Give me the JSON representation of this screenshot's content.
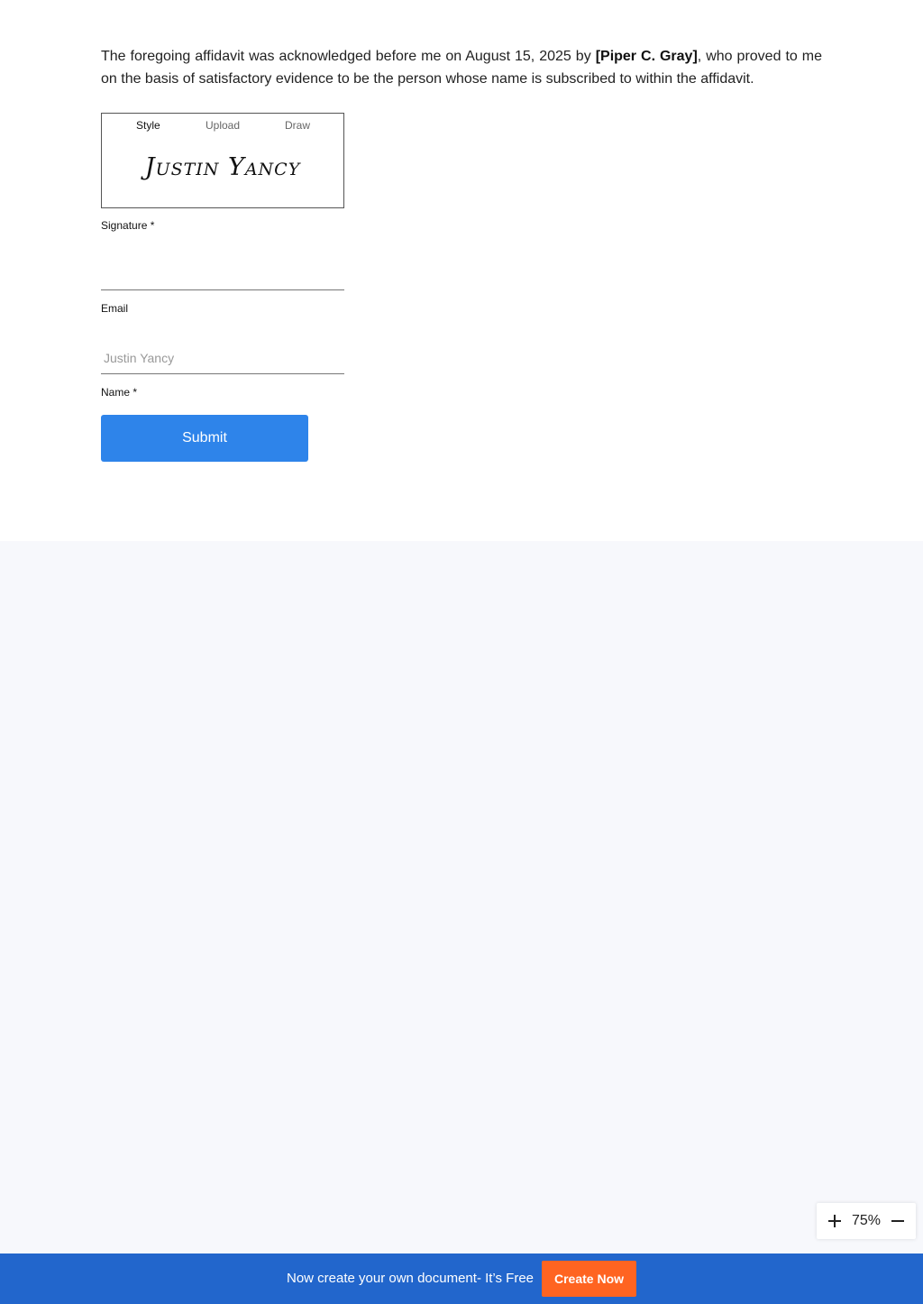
{
  "document": {
    "paragraph": {
      "before": "The foregoing affidavit was acknowledged before me on August 15, 2025 by ",
      "name": "[Piper C. Gray]",
      "after": ", who proved to me on the basis of satisfactory evidence to be the person whose name is subscribed to within the affidavit."
    }
  },
  "signature_box": {
    "tabs": [
      {
        "label": "Style",
        "active": true
      },
      {
        "label": "Upload",
        "active": false
      },
      {
        "label": "Draw",
        "active": false
      }
    ],
    "signature_text": "Justin Yancy"
  },
  "form": {
    "signature_label": "Signature *",
    "email_label": "Email",
    "email_placeholder": "Justin Yancy",
    "name_label": "Name *",
    "submit_label": "Submit"
  },
  "zoom": {
    "level": "75%"
  },
  "bottom_bar": {
    "promo_text": "Now create your own document- It’s Free",
    "create_label": "Create Now"
  },
  "colors": {
    "submit": "#2e84ea",
    "bottom_bar": "#2266cc",
    "create_button": "#ff6421"
  }
}
